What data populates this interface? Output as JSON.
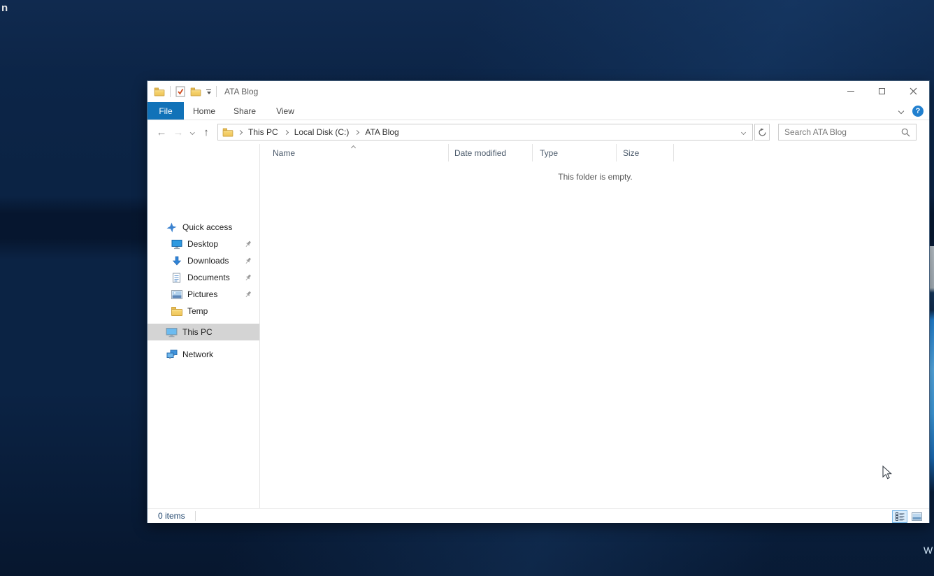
{
  "desktop": {
    "stray_top_left": "n",
    "stray_bottom_right": "W"
  },
  "titlebar": {
    "title": "ATA Blog"
  },
  "ribbon": {
    "tabs": [
      {
        "label": "File"
      },
      {
        "label": "Home"
      },
      {
        "label": "Share"
      },
      {
        "label": "View"
      }
    ],
    "active_tab": "File",
    "help_glyph": "?"
  },
  "address_bar": {
    "breadcrumbs": [
      "This PC",
      "Local Disk (C:)",
      "ATA Blog"
    ]
  },
  "search": {
    "placeholder": "Search ATA Blog"
  },
  "sidebar": {
    "items": [
      {
        "label": "Quick access",
        "icon": "quick-access-star-icon",
        "pinned": false,
        "selected": false
      },
      {
        "label": "Desktop",
        "icon": "desktop-icon",
        "pinned": true,
        "selected": false
      },
      {
        "label": "Downloads",
        "icon": "downloads-icon",
        "pinned": true,
        "selected": false
      },
      {
        "label": "Documents",
        "icon": "documents-icon",
        "pinned": true,
        "selected": false
      },
      {
        "label": "Pictures",
        "icon": "pictures-icon",
        "pinned": true,
        "selected": false
      },
      {
        "label": "Temp",
        "icon": "folder-icon",
        "pinned": false,
        "selected": false
      },
      {
        "label": "This PC",
        "icon": "computer-icon",
        "pinned": false,
        "selected": true
      },
      {
        "label": "Network",
        "icon": "network-icon",
        "pinned": false,
        "selected": false
      }
    ]
  },
  "file_list": {
    "columns": [
      {
        "label": "Name"
      },
      {
        "label": "Date modified"
      },
      {
        "label": "Type"
      },
      {
        "label": "Size"
      }
    ],
    "sort_column": "Name",
    "sort_direction": "ascending",
    "empty_message": "This folder is empty."
  },
  "status_bar": {
    "items_count": "0 items"
  },
  "colors": {
    "file_tab_blue": "#1172b8",
    "help_blue": "#2180cf",
    "folder_yellow": "#f5d26d",
    "selection_gray": "#d4d4d4"
  }
}
